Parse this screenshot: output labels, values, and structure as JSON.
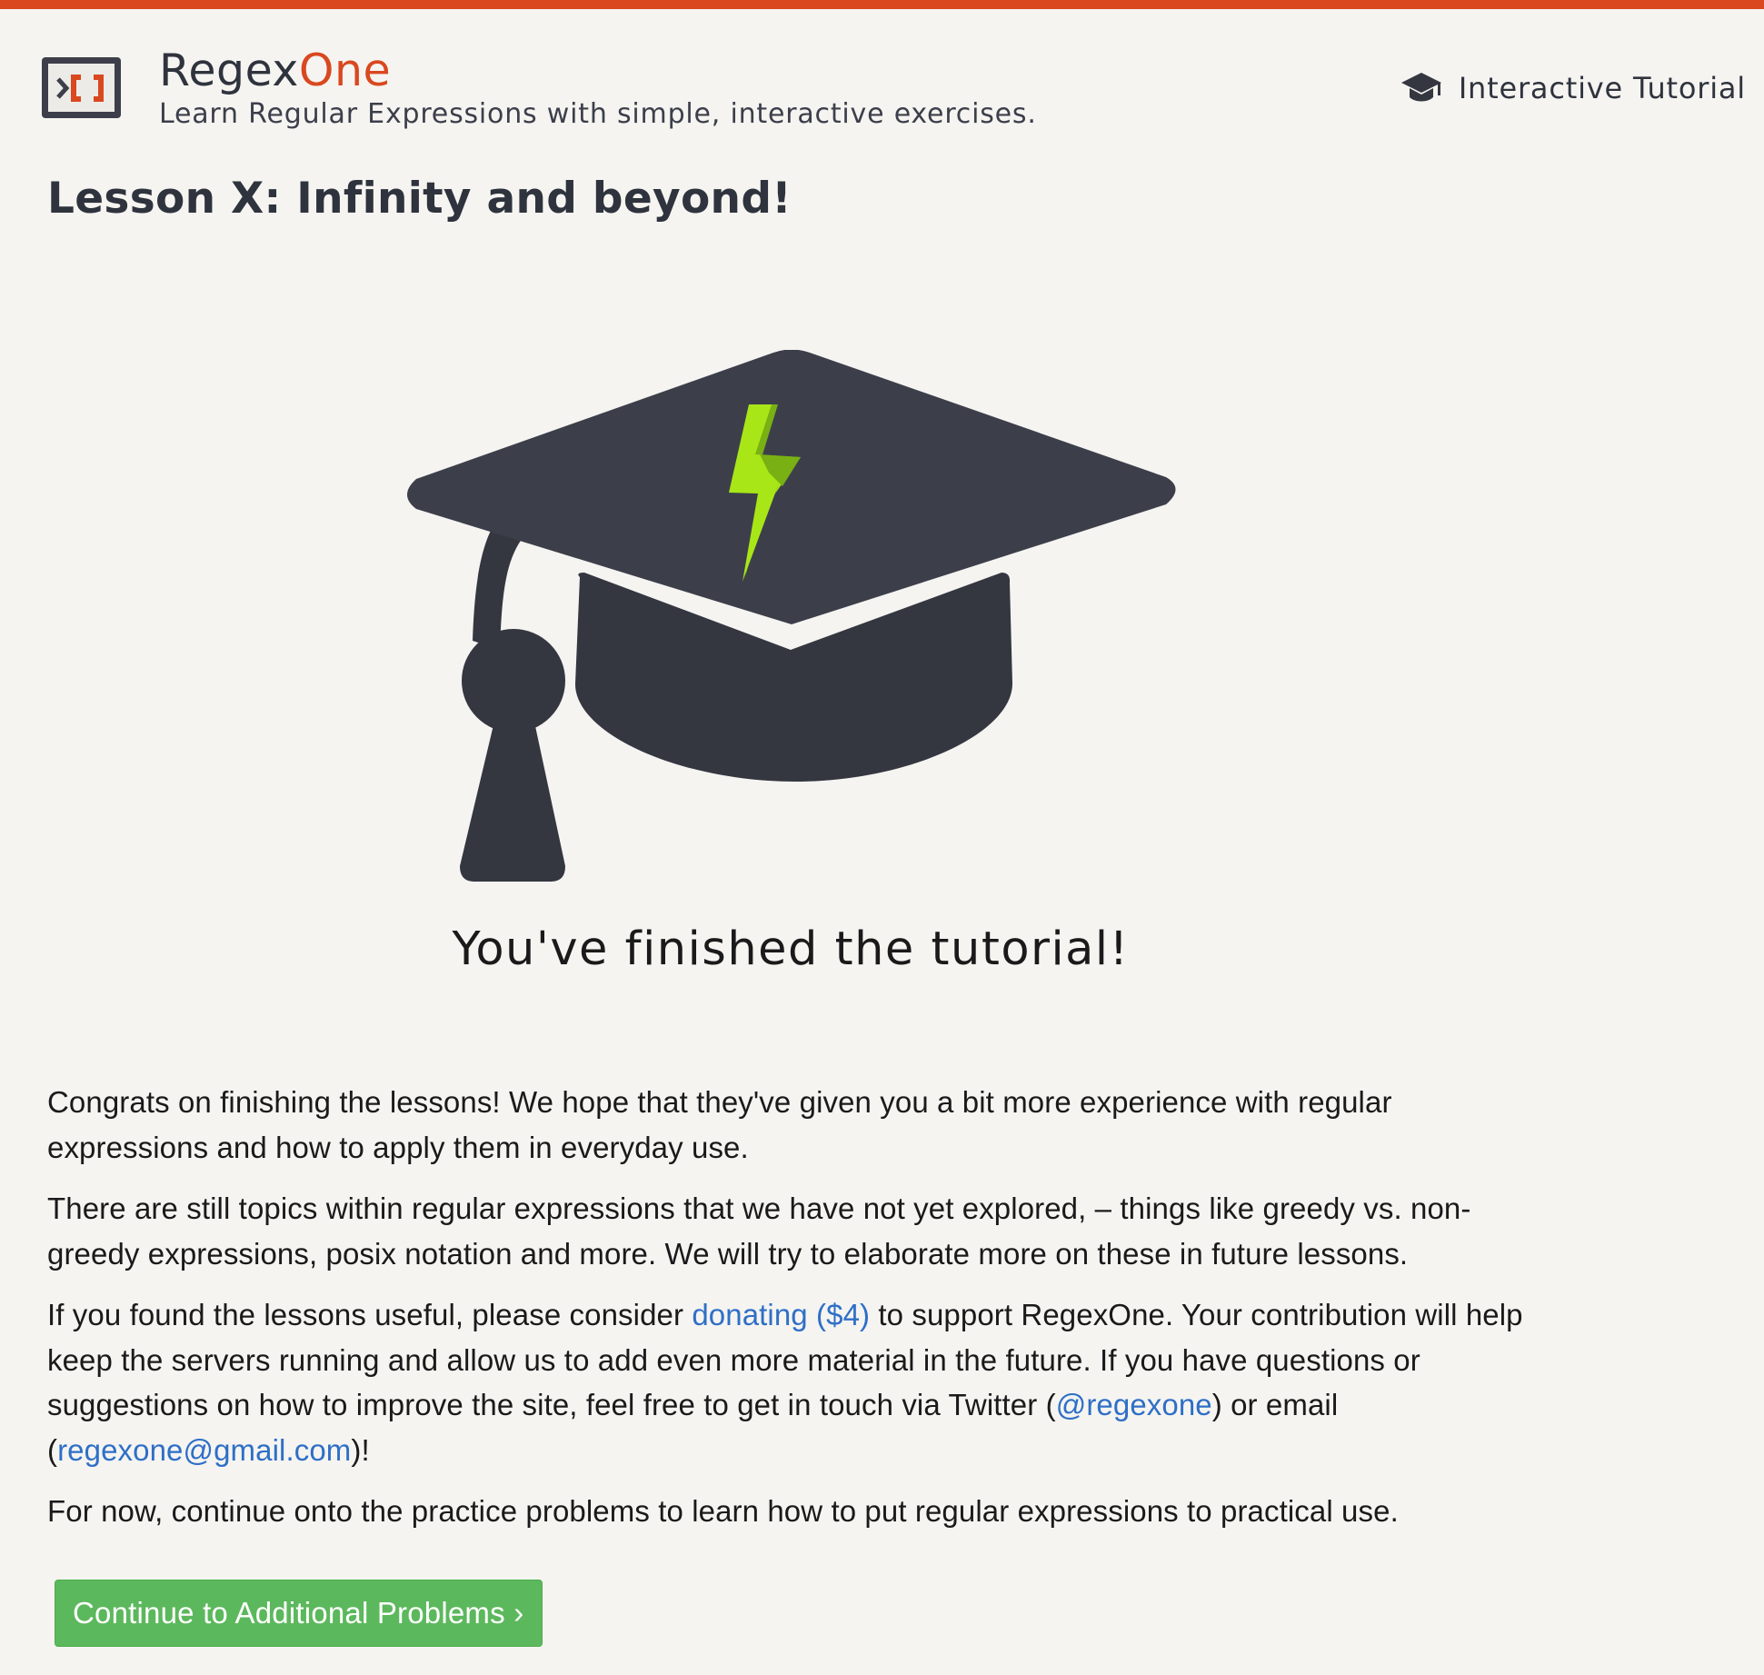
{
  "colors": {
    "accent": "#d9481f",
    "background": "#f5f4f1",
    "text": "#1a1a1a",
    "heading": "#2f333d",
    "link": "#2f6fc6",
    "button": "#5cb85c",
    "button_border": "#4cae4c",
    "button_text": "#ffffff",
    "cap_body": "#343740",
    "cap_top": "#3c3f4a",
    "bolt_light": "#a9e618",
    "bolt_dark": "#79b013"
  },
  "header": {
    "logo_icon": "terminal-brackets-icon",
    "brand_primary": "Regex",
    "brand_accent": "One",
    "tagline": "Learn Regular Expressions with simple, interactive exercises.",
    "nav": {
      "icon": "graduation-cap-icon",
      "label": "Interactive Tutorial"
    }
  },
  "lesson": {
    "title": "Lesson X: Infinity and beyond!",
    "illustration_icon": "graduation-cap-lightning-icon",
    "finished_text": "You've finished the tutorial!",
    "paragraphs": {
      "p1": "Congrats on finishing the lessons! We hope that they've given you a bit more experience with regular expressions and how to apply them in everyday use.",
      "p2": "There are still topics within regular expressions that we have not yet explored, – things like greedy vs. non-greedy expressions, posix notation and more. We will try to elaborate more on these in future lessons.",
      "p3": {
        "part1": "If you found the lessons useful, please consider ",
        "donate_link": "donating ($4)",
        "part2": " to support RegexOne. Your contribution will help keep the servers running and allow us to add even more material in the future. If you have questions or suggestions on how to improve the site, feel free to get in touch via Twitter (",
        "twitter_link": "@regexone",
        "part3": ") or email (",
        "email_link": "regexone@gmail.com",
        "part4": ")!"
      },
      "p4": "For now, continue onto the practice problems to learn how to put regular expressions to practical use."
    },
    "continue_button": "Continue to Additional Problems ›"
  }
}
